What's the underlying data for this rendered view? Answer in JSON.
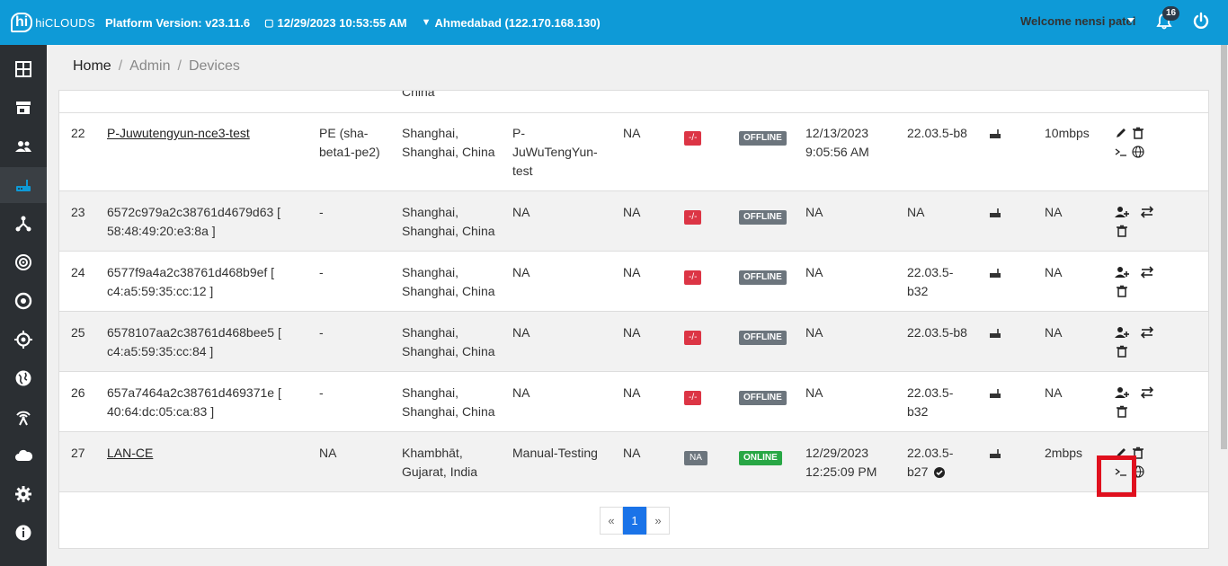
{
  "topbar": {
    "logo_mark": "hi",
    "logo_text": "hiCLOUDS",
    "platform_version": "Platform Version: v23.11.6",
    "datetime": "12/29/2023 10:53:55 AM",
    "location": "Ahmedabad (122.170.168.130)",
    "welcome": "Welcome nensi patel",
    "notification_count": "16"
  },
  "sidebar": {
    "items": [
      "dashboard-icon",
      "store-icon",
      "users-icon",
      "router-icon",
      "network-icon",
      "signal-icon",
      "target-icon",
      "crosshair-icon",
      "globe-icon",
      "antenna-icon",
      "cloud-icon",
      "gear-icon",
      "info-icon"
    ],
    "active": "router-icon"
  },
  "breadcrumb": {
    "home": "Home",
    "admin": "Admin",
    "devices": "Devices",
    "separator": "/"
  },
  "table": {
    "partial_location": "China",
    "rows": [
      {
        "id": "22",
        "name": "P-Juwutengyun-nce3-test",
        "name_line2": "",
        "type": "PE (sha-",
        "type2": "beta1-pe2)",
        "loc1": "Shanghai,",
        "loc2": "Shanghai, China",
        "group1": "P-",
        "group2": "JuWuTengYun-",
        "group3": "test",
        "col5": "NA",
        "vpn": "-/-",
        "status": "OFFLINE",
        "seen1": "12/13/2023",
        "seen2": "9:05:56 AM",
        "fw1": "22.03.5-b8",
        "fw2": "",
        "bw": "10mbps"
      },
      {
        "id": "23",
        "name": "6572c979a2c38761d4679d63 [",
        "name_line2": "58:48:49:20:e3:8a ]",
        "type": "-",
        "type2": "",
        "loc1": "Shanghai,",
        "loc2": "Shanghai, China",
        "group1": "NA",
        "group2": "",
        "group3": "",
        "col5": "NA",
        "vpn": "-/-",
        "status": "OFFLINE",
        "seen1": "NA",
        "seen2": "",
        "fw1": "NA",
        "fw2": "",
        "bw": "NA"
      },
      {
        "id": "24",
        "name": "6577f9a4a2c38761d468b9ef [",
        "name_line2": "c4:a5:59:35:cc:12 ]",
        "type": "-",
        "type2": "",
        "loc1": "Shanghai,",
        "loc2": "Shanghai, China",
        "group1": "NA",
        "group2": "",
        "group3": "",
        "col5": "NA",
        "vpn": "-/-",
        "status": "OFFLINE",
        "seen1": "NA",
        "seen2": "",
        "fw1": "22.03.5-",
        "fw2": "b32",
        "bw": "NA"
      },
      {
        "id": "25",
        "name": "6578107aa2c38761d468bee5 [",
        "name_line2": "c4:a5:59:35:cc:84 ]",
        "type": "-",
        "type2": "",
        "loc1": "Shanghai,",
        "loc2": "Shanghai, China",
        "group1": "NA",
        "group2": "",
        "group3": "",
        "col5": "NA",
        "vpn": "-/-",
        "status": "OFFLINE",
        "seen1": "NA",
        "seen2": "",
        "fw1": "22.03.5-b8",
        "fw2": "",
        "bw": "NA"
      },
      {
        "id": "26",
        "name": "657a7464a2c38761d469371e [",
        "name_line2": "40:64:dc:05:ca:83 ]",
        "type": "-",
        "type2": "",
        "loc1": "Shanghai,",
        "loc2": "Shanghai, China",
        "group1": "NA",
        "group2": "",
        "group3": "",
        "col5": "NA",
        "vpn": "-/-",
        "status": "OFFLINE",
        "seen1": "NA",
        "seen2": "",
        "fw1": "22.03.5-",
        "fw2": "b32",
        "bw": "NA"
      },
      {
        "id": "27",
        "name": "LAN-CE",
        "name_line2": "",
        "type": "NA",
        "type2": "",
        "loc1": "Khambhāt,",
        "loc2": "Gujarat, India",
        "group1": "Manual-Testing",
        "group2": "",
        "group3": "",
        "col5": "NA",
        "vpn": "NA",
        "status": "ONLINE",
        "seen1": "12/29/2023",
        "seen2": "12:25:09 PM",
        "fw1": "22.03.5-",
        "fw2": "b27",
        "bw": "2mbps"
      }
    ]
  },
  "pagination": {
    "prev": "«",
    "current": "1",
    "next": "»"
  },
  "colors": {
    "topbar": "#0e9ad7",
    "sidebar": "#2b2f33",
    "offline": "#6c757d",
    "online": "#28a745",
    "vpn_tag": "#dc3545",
    "highlight": "#e0101e",
    "page_active": "#1a73e8"
  }
}
